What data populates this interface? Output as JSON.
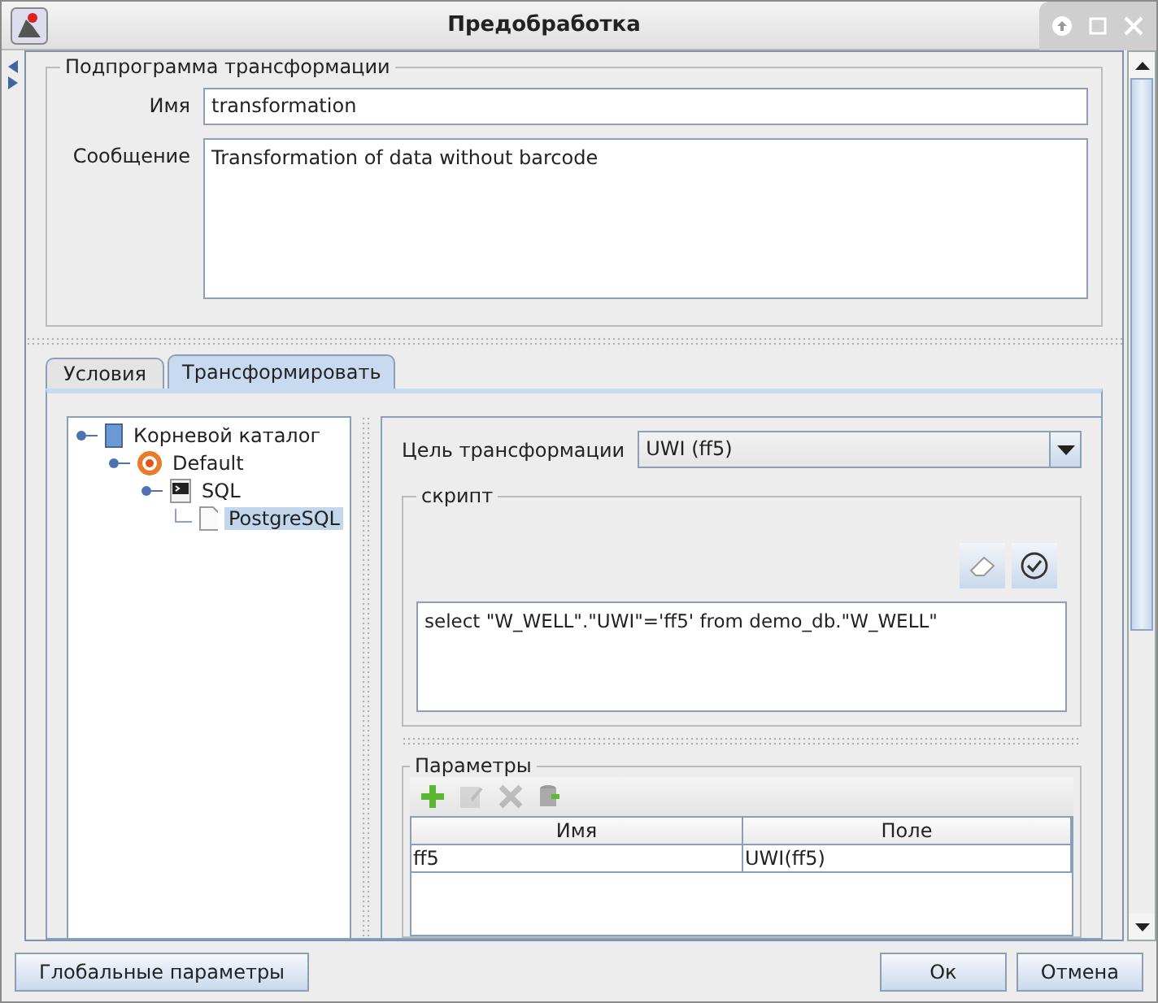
{
  "window": {
    "title": "Предобработка"
  },
  "subroutine": {
    "title": "Подпрограмма трансформации",
    "name_label": "Имя",
    "name_value": "transformation",
    "message_label": "Сообщение",
    "message_value": "Transformation of data without barcode"
  },
  "tabs": [
    {
      "label": "Условия",
      "selected": false
    },
    {
      "label": "Трансформировать",
      "selected": true
    }
  ],
  "tree": [
    {
      "label": "Корневой каталог",
      "kind": "root",
      "selected": false,
      "expanded": true,
      "children": [
        {
          "label": "Default",
          "kind": "schema",
          "selected": false,
          "expanded": true,
          "children": [
            {
              "label": "SQL",
              "kind": "console",
              "selected": false,
              "expanded": true,
              "children": [
                {
                  "label": "PostgreSQL",
                  "kind": "file",
                  "selected": true
                }
              ]
            }
          ]
        }
      ]
    }
  ],
  "target": {
    "label": "Цель трансформации",
    "value": "UWI (ff5)"
  },
  "script": {
    "title": "скрипт",
    "text": "select \"W_WELL\".\"UWI\"='ff5' from demo_db.\"W_WELL\""
  },
  "parameters": {
    "title": "Параметры",
    "tools": [
      {
        "kind": "add",
        "disabled": false
      },
      {
        "kind": "edit",
        "disabled": true
      },
      {
        "kind": "delete",
        "disabled": true
      },
      {
        "kind": "import",
        "disabled": false
      }
    ],
    "columns": [
      "Имя",
      "Поле"
    ],
    "rows": [
      [
        "ff5",
        "UWI(ff5)"
      ]
    ]
  },
  "buttons": {
    "left": [
      "Глобальные параметры"
    ],
    "right": [
      "Ок",
      "Отмена"
    ]
  }
}
